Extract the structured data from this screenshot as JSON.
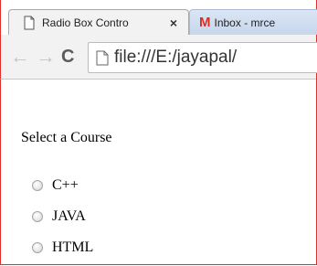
{
  "browser": {
    "tabs": [
      {
        "title": "Radio Box Contro",
        "active": true,
        "icon": "page-icon",
        "close": "×"
      },
      {
        "title": "Inbox - mrce",
        "active": false,
        "icon": "gmail-icon",
        "glyph": "M"
      }
    ],
    "toolbar": {
      "back": "←",
      "forward": "→",
      "reload": "C",
      "url": "file:///E:/jayapal/"
    }
  },
  "page": {
    "prompt": "Select a Course",
    "options": [
      "C++",
      "JAVA",
      "HTML"
    ]
  },
  "colors": {
    "frame_border": "#e0302b",
    "inactive_tab": "#c6d6ec",
    "gmail_red": "#d93025"
  }
}
